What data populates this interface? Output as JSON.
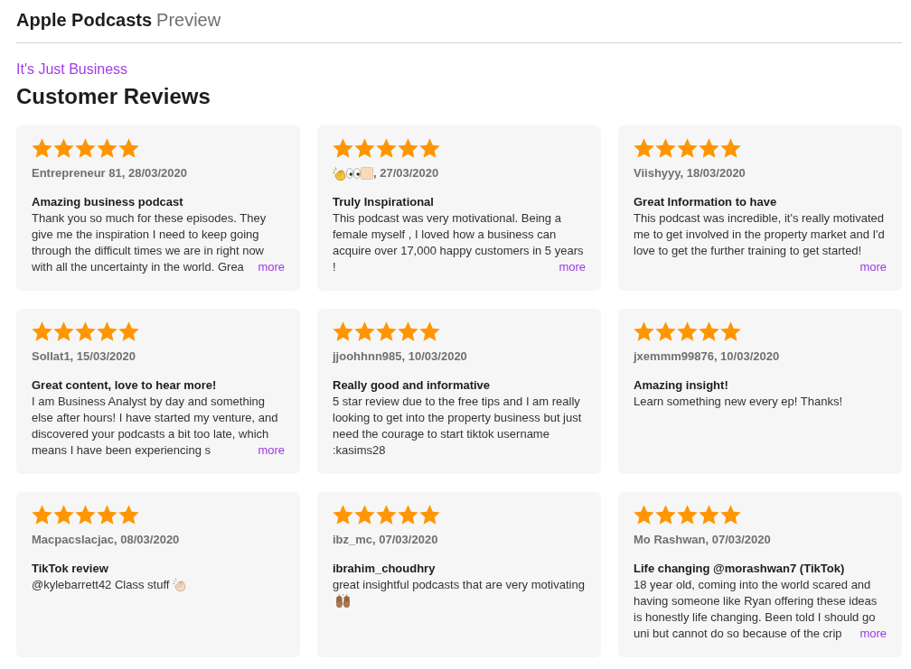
{
  "header": {
    "title": "Apple Podcasts",
    "subtitle": "Preview"
  },
  "podcast_link": "It's Just Business",
  "section_title": "Customer Reviews",
  "reviews": [
    {
      "stars": 5,
      "byline": "Entrepreneur 81, 28/03/2020",
      "title": "Amazing business podcast",
      "body": "Thank you so much for these episodes. They give me the inspiration I need to keep going through the difficult times we are in right now with all the uncertainty in the world. Grea",
      "more": "more"
    },
    {
      "stars": 5,
      "byline_emoji": [
        {
          "kind": "clapping-hands"
        },
        {
          "kind": "eyes"
        },
        {
          "kind": "skin-tone-swatch"
        }
      ],
      "byline": ", 27/03/2020",
      "title": "Truly Inspirational",
      "body": "This podcast was very motivational. Being a female myself , I loved how a business can acquire over 17,000 happy customers in 5 years !",
      "more": "more"
    },
    {
      "stars": 5,
      "byline": "Viishyyy, 18/03/2020",
      "title": "Great Information to have",
      "body": "This podcast was incredible, it's really motivated me to get involved in the property market and I'd love to get the further training to get started!",
      "more": "more"
    },
    {
      "stars": 5,
      "byline": "Sollat1, 15/03/2020",
      "title": "Great content, love to hear more!",
      "body": "I am Business Analyst by day and something else after hours! I have started my venture, and discovered your podcasts a bit too late, which means I have been experiencing s",
      "more": "more"
    },
    {
      "stars": 5,
      "byline": "jjoohhnn985, 10/03/2020",
      "title": "Really good and informative",
      "body": "5 star review due to the free tips and I am really looking to get into the property business but just need the courage to start tiktok username :kasims28"
    },
    {
      "stars": 5,
      "byline": "jxemmm99876, 10/03/2020",
      "title": "Amazing insight!",
      "body": "Learn something new every ep! Thanks!"
    },
    {
      "stars": 5,
      "byline": "Macpacslacjac, 08/03/2020",
      "title": "TikTok review",
      "body": "@kylebarrett42 Class stuff",
      "body_emoji": {
        "kind": "clapping-hands-light"
      }
    },
    {
      "stars": 5,
      "byline": "ibz_mc, 07/03/2020",
      "title": "ibrahim_choudhry",
      "body": "great insightful podcasts that are very motivating",
      "body_emoji": {
        "kind": "raised-hands"
      }
    },
    {
      "stars": 5,
      "byline": "Mo Rashwan, 07/03/2020",
      "title": "Life changing @morashwan7 (TikTok)",
      "body": "18 year old, coming into the world scared and having someone like Ryan offering these ideas is honestly life changing. Been told I should go uni but cannot do so because of the crip",
      "more": "more"
    }
  ]
}
